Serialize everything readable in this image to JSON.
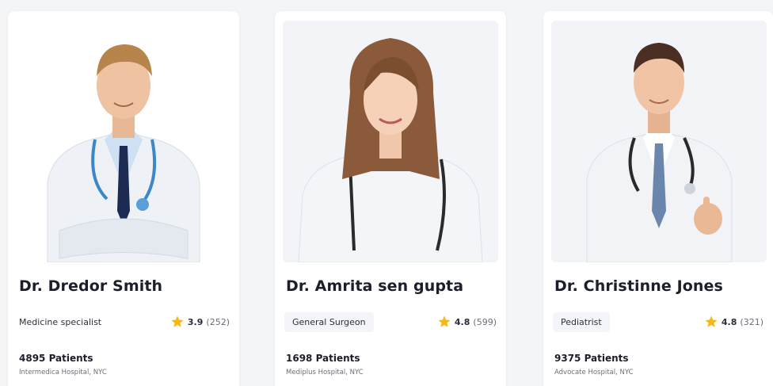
{
  "doctors": [
    {
      "name": "Dr. Dredor Smith",
      "specialty": "Medicine specialist",
      "rating": "3.9",
      "reviews": "(252)",
      "patients": "4895 Patients",
      "hospital": "Intermedica Hospital, NYC"
    },
    {
      "name": "Dr. Amrita sen gupta",
      "specialty": "General Surgeon",
      "rating": "4.8",
      "reviews": "(599)",
      "patients": "1698 Patients",
      "hospital": "Mediplus Hospital, NYC"
    },
    {
      "name": "Dr. Christinne Jones",
      "specialty": "Pediatrist",
      "rating": "4.8",
      "reviews": "(321)",
      "patients": "9375 Patients",
      "hospital": "Advocate Hospital, NYC"
    }
  ],
  "icons": {
    "rating": "star-icon"
  },
  "colors": {
    "star": "#f5b71a",
    "text": "#1c1f2b",
    "muted": "#6b6f7a",
    "chip": "#f4f5f8"
  }
}
